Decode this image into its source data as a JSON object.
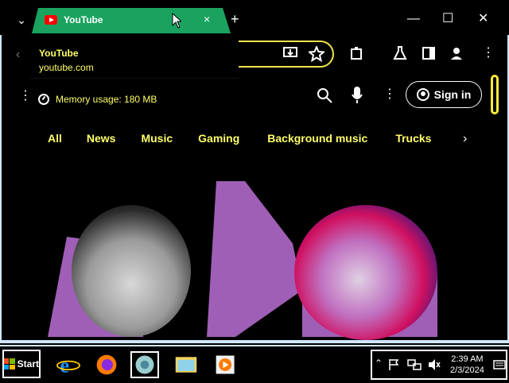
{
  "window": {
    "tab_title": "YouTube",
    "tab_close": "×",
    "new_tab": "+",
    "tab_search": "⌄",
    "minimize": "—",
    "maximize": "☐",
    "close": "✕"
  },
  "hovercard": {
    "title": "YouTube",
    "url": "youtube.com"
  },
  "toolbar": {
    "back": "‹"
  },
  "memory": {
    "text": "Memory usage: 180 MB"
  },
  "youtube": {
    "sign_in": "Sign in",
    "chips": [
      "All",
      "News",
      "Music",
      "Gaming",
      "Background music",
      "Trucks"
    ],
    "chip_arrow": "›"
  },
  "taskbar": {
    "start_label": "Start",
    "time": "2:39 AM",
    "date": "2/3/2024"
  },
  "colors": {
    "tab_accent": "#1aa35f",
    "link_yellow": "#ffff6a",
    "focus_yellow": "#f3e44a",
    "hero_purple": "#a05fb6",
    "frame": "#cfe7ff"
  }
}
